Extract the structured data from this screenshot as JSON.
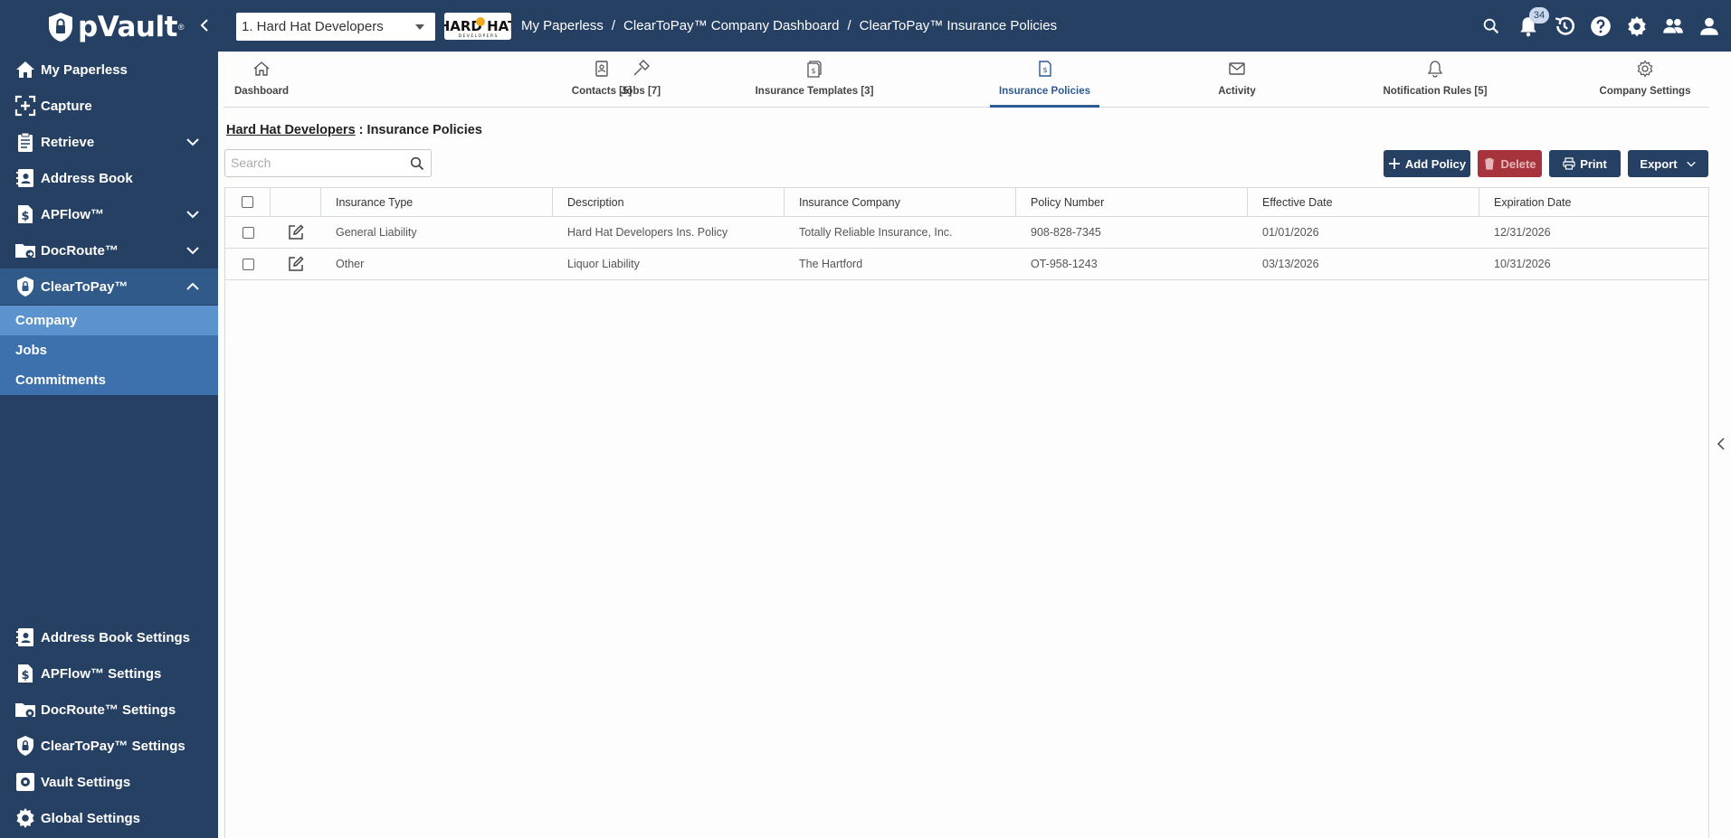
{
  "app": {
    "brand": "pVault",
    "brand_mark": "®"
  },
  "topbar": {
    "company_selected": "1. Hard Hat Developers",
    "company_logo_alt": "HARD HAT DEVELOPERS",
    "breadcrumbs": [
      "My Paperless",
      "ClearToPay™ Company Dashboard",
      "ClearToPay™ Insurance Policies"
    ],
    "breadcrumb_separator": "/",
    "notification_count": "34",
    "icons": [
      "search-icon",
      "bell-icon",
      "history-icon",
      "help-icon",
      "settings-icon",
      "users-icon",
      "profile-icon"
    ]
  },
  "sidebar": {
    "items": [
      {
        "label": "My Paperless",
        "icon": "home-icon"
      },
      {
        "label": "Capture",
        "icon": "capture-icon"
      },
      {
        "label": "Retrieve",
        "icon": "clipboard-icon",
        "expandable": true
      },
      {
        "label": "Address Book",
        "icon": "address-book-icon"
      },
      {
        "label": "APFlow™",
        "icon": "dollar-doc-icon",
        "expandable": true
      },
      {
        "label": "DocRoute™",
        "icon": "folder-route-icon",
        "expandable": true
      },
      {
        "label": "ClearToPay™",
        "icon": "shield-lock-icon",
        "expanded": true
      }
    ],
    "subitems": [
      "Company",
      "Jobs",
      "Commitments"
    ],
    "selected_subitem": "Company",
    "settings": [
      {
        "label": "Address Book Settings",
        "icon": "address-book-settings-icon"
      },
      {
        "label": "APFlow™ Settings",
        "icon": "apflow-settings-icon"
      },
      {
        "label": "DocRoute™ Settings",
        "icon": "docroute-settings-icon"
      },
      {
        "label": "ClearToPay™ Settings",
        "icon": "cleartopay-settings-icon"
      },
      {
        "label": "Vault Settings",
        "icon": "vault-settings-icon"
      },
      {
        "label": "Global Settings",
        "icon": "gear-icon"
      }
    ]
  },
  "tabs": [
    {
      "label": "Dashboard",
      "icon": "home-icon"
    },
    {
      "label": "Jobs [7]",
      "icon": "hammer-icon"
    },
    {
      "label": "Contacts [5]",
      "icon": "contacts-icon"
    },
    {
      "label": "Insurance Templates [3]",
      "icon": "insurance-templates-icon"
    },
    {
      "label": "Insurance Policies",
      "icon": "insurance-policy-icon",
      "active": true
    },
    {
      "label": "Activity",
      "icon": "mail-icon"
    },
    {
      "label": "Notification Rules [5]",
      "icon": "bell-icon"
    },
    {
      "label": "Company Settings",
      "icon": "gear-icon"
    }
  ],
  "page": {
    "company_link": "Hard Hat Developers",
    "title_separator": ":",
    "title": "Insurance Policies"
  },
  "search": {
    "placeholder": "Search",
    "value": ""
  },
  "toolbar": {
    "add_label": "Add Policy",
    "delete_label": "Delete",
    "print_label": "Print",
    "export_label": "Export"
  },
  "table": {
    "columns": [
      "Insurance Type",
      "Description",
      "Insurance Company",
      "Policy Number",
      "Effective Date",
      "Expiration Date"
    ],
    "rows": [
      [
        "General Liability",
        "Hard Hat Developers Ins. Policy",
        "Totally Reliable Insurance, Inc.",
        "908-828-7345",
        "01/01/2026",
        "12/31/2026"
      ],
      [
        "Other",
        "Liquor Liability",
        "The Hartford",
        "OT-958-1243",
        "03/13/2026",
        "10/31/2026"
      ]
    ]
  },
  "colors": {
    "navy": "#254063",
    "sidebar_sub": "#3c71ae",
    "sidebar_selected": "#5b93cf",
    "accent": "#2d5a94",
    "danger": "#a7333c"
  }
}
